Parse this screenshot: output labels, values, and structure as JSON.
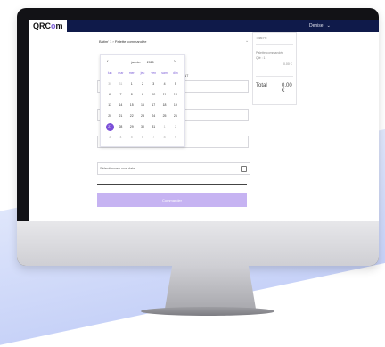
{
  "app": {
    "logo_prefix": "QRC",
    "logo_accent": "o",
    "logo_suffix": "m",
    "user_menu": "Denise",
    "accent_color": "#7b4fd8"
  },
  "form": {
    "breadcrumb": "Bâtim' 1 › Palette commandée",
    "field_label_client": "CLIENT",
    "date_placeholder": "Sélectionnez une date",
    "submit_label": "Commander"
  },
  "calendar": {
    "month": "janvier",
    "year": "2025",
    "weekdays": [
      "lun",
      "mar",
      "mer",
      "jeu",
      "ven",
      "sam",
      "dim"
    ],
    "weeks": [
      [
        "30",
        "31",
        "1",
        "2",
        "3",
        "4",
        "5"
      ],
      [
        "6",
        "7",
        "8",
        "9",
        "10",
        "11",
        "12"
      ],
      [
        "13",
        "14",
        "15",
        "16",
        "17",
        "18",
        "19"
      ],
      [
        "20",
        "21",
        "22",
        "23",
        "24",
        "25",
        "26"
      ],
      [
        "27",
        "28",
        "29",
        "30",
        "31",
        "1",
        "2"
      ],
      [
        "3",
        "4",
        "5",
        "6",
        "7",
        "8",
        "9"
      ]
    ],
    "selected_day": "27"
  },
  "summary": {
    "heading": "Total HT",
    "section_label": "Palette commandée",
    "item_label": "Qté : 1",
    "item_value": "0.00 €",
    "total_label": "Total",
    "total_value": "0.00 €"
  }
}
